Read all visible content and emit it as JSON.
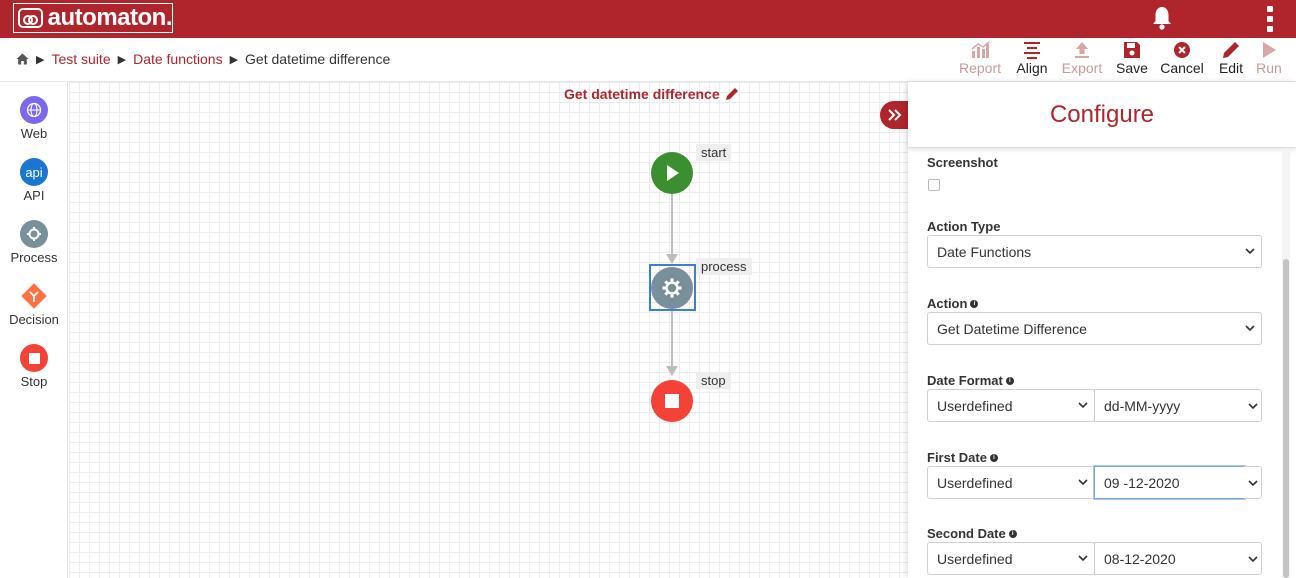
{
  "app": {
    "logo_text": "automaton."
  },
  "breadcrumb": {
    "items": [
      "Test suite",
      "Date functions"
    ],
    "current": "Get datetime difference"
  },
  "toolbar": {
    "report": "Report",
    "align": "Align",
    "export": "Export",
    "save": "Save",
    "cancel": "Cancel",
    "edit": "Edit",
    "run": "Run"
  },
  "palette": [
    {
      "label": "Web",
      "icon": "globe-icon",
      "color": "#7b68ee"
    },
    {
      "label": "API",
      "icon": "api-icon",
      "icon_text": "api",
      "color": "#1976d2"
    },
    {
      "label": "Process",
      "icon": "gear-icon",
      "color": "#78909c"
    },
    {
      "label": "Decision",
      "icon": "decision-icon",
      "color": "#ff7043"
    },
    {
      "label": "Stop",
      "icon": "stop-icon",
      "color": "#f44336"
    }
  ],
  "canvas": {
    "flow_title": "Get datetime difference",
    "nodes": {
      "start": "start",
      "process": "process",
      "stop": "stop"
    }
  },
  "configure": {
    "title": "Configure",
    "screenshot_label": "Screenshot",
    "action_type_label": "Action Type",
    "action_type_value": "Date Functions",
    "action_label": "Action",
    "action_value": "Get Datetime Difference",
    "date_format_label": "Date Format",
    "date_format_type": "Userdefined",
    "date_format_value": "dd-MM-yyyy",
    "first_date_label": "First Date",
    "first_date_type": "Userdefined",
    "first_date_value": "09 -12-2020",
    "second_date_label": "Second Date",
    "second_date_type": "Userdefined",
    "second_date_value": "08-12-2020"
  },
  "colors": {
    "brand": "#b0252b",
    "start": "#3a8f2f",
    "process": "#78909c",
    "stop": "#f44336",
    "focus": "#3d7fd6"
  }
}
